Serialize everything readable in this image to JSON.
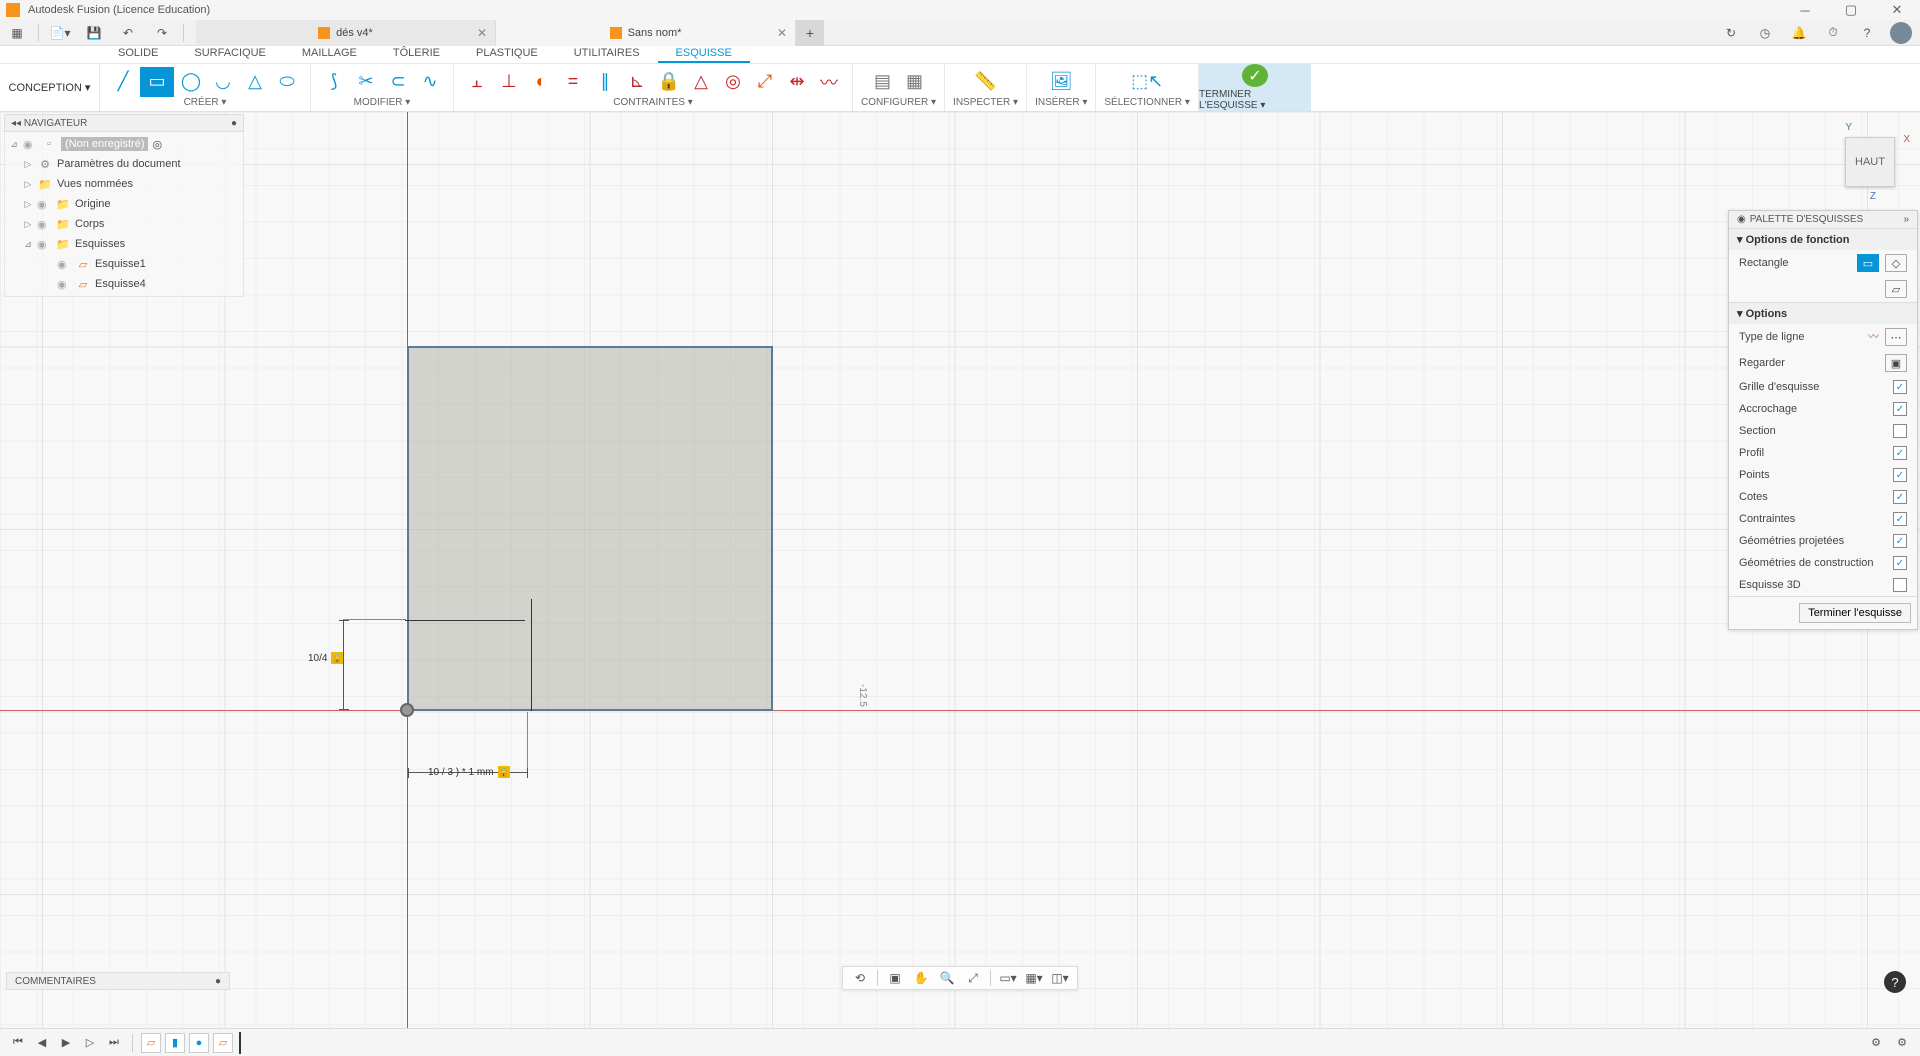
{
  "title": "Autodesk Fusion (Licence Education)",
  "doc_tabs": [
    {
      "label": "dés v4*",
      "active": false
    },
    {
      "label": "Sans nom*",
      "active": true
    }
  ],
  "workspace": "CONCEPTION",
  "sec_tabs": [
    "SOLIDE",
    "SURFACIQUE",
    "MAILLAGE",
    "TÔLERIE",
    "PLASTIQUE",
    "UTILITAIRES",
    "ESQUISSE"
  ],
  "sec_active": "ESQUISSE",
  "ribbon_groups": {
    "create": "CRÉER",
    "modify": "MODIFIER",
    "constraints": "CONTRAINTES",
    "configure": "CONFIGURER",
    "inspect": "INSPECTER",
    "insert": "INSÉRER",
    "select": "SÉLECTIONNER",
    "finish": "TERMINER L'ESQUISSE"
  },
  "browser": {
    "title": "NAVIGATEUR",
    "root": "(Non enregistré)",
    "items": [
      "Paramètres du document",
      "Vues nommées",
      "Origine",
      "Corps",
      "Esquisses"
    ],
    "sketches": [
      "Esquisse1",
      "Esquisse4"
    ]
  },
  "viewcube": {
    "label": "HAUT",
    "x": "X",
    "y": "Y",
    "z": "Z"
  },
  "dims": {
    "v": "10/4",
    "h": "10 / 3 ) * 1 mm"
  },
  "canvas_label": "-12.5",
  "palette": {
    "title": "PALETTE D'ESQUISSES",
    "section_feature": "Options de fonction",
    "feature_label": "Rectangle",
    "section_options": "Options",
    "rows": [
      {
        "label": "Type de ligne",
        "type": "icons"
      },
      {
        "label": "Regarder",
        "type": "look"
      },
      {
        "label": "Grille d'esquisse",
        "type": "check",
        "checked": true
      },
      {
        "label": "Accrochage",
        "type": "check",
        "checked": true
      },
      {
        "label": "Section",
        "type": "check",
        "checked": false
      },
      {
        "label": "Profil",
        "type": "check",
        "checked": true
      },
      {
        "label": "Points",
        "type": "check",
        "checked": true
      },
      {
        "label": "Cotes",
        "type": "check",
        "checked": true
      },
      {
        "label": "Contraintes",
        "type": "check",
        "checked": true
      },
      {
        "label": "Géométries projetées",
        "type": "check",
        "checked": true
      },
      {
        "label": "Géométries de construction",
        "type": "check",
        "checked": true
      },
      {
        "label": "Esquisse 3D",
        "type": "check",
        "checked": false
      }
    ],
    "finish_button": "Terminer l'esquisse"
  },
  "comments": "COMMENTAIRES"
}
